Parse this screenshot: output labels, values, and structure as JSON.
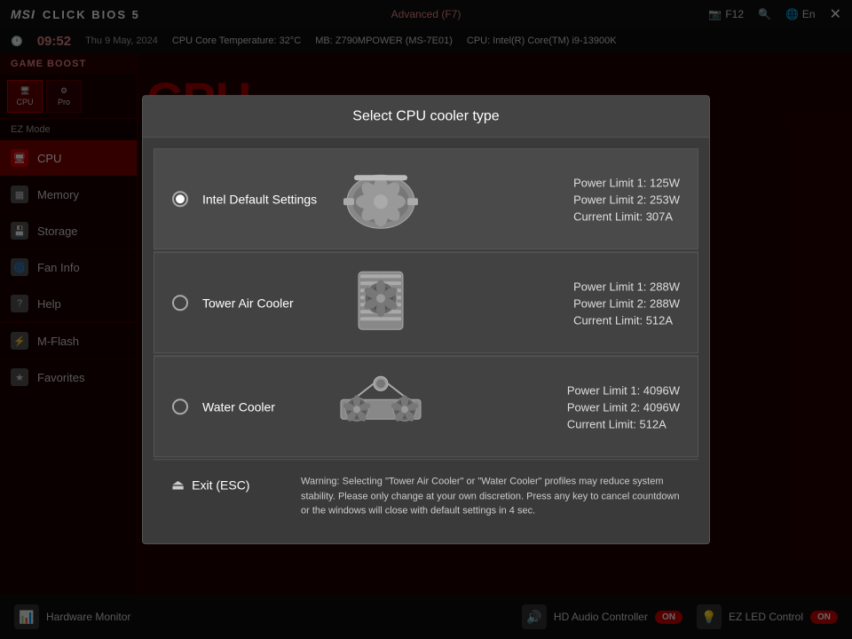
{
  "app": {
    "logo": "MSI",
    "title": "CLICK BIOS 5",
    "mode": "Advanced (F7)",
    "f12_label": "F12",
    "lang": "En"
  },
  "clock": {
    "time": "09:52",
    "date": "Thu 9 May, 2024"
  },
  "temps": {
    "cpu_core": "CPU Core Temperature: 32°C",
    "mb": "MB: Z790MPOWER (MS-7E01)",
    "cpu_info": "CPU: Intel(R) Core(TM) i9-13900K"
  },
  "sidebar": {
    "game_boost": "GAME BOOST",
    "ez_mode": "EZ Mode",
    "items": [
      {
        "id": "cpu",
        "label": "CPU",
        "active": true
      },
      {
        "id": "memory",
        "label": "Memory",
        "active": false
      },
      {
        "id": "storage",
        "label": "Storage",
        "active": false
      },
      {
        "id": "fan-info",
        "label": "Fan Info",
        "active": false
      },
      {
        "id": "help",
        "label": "Help",
        "active": false
      }
    ],
    "m_flash": "M-Flash",
    "favorites": "Favorites"
  },
  "bottom_bar": {
    "hw_monitor": "Hardware Monitor",
    "hd_audio": "HD Audio Controller",
    "hd_toggle": "ON",
    "ez_led": "EZ LED Control",
    "ez_toggle": "ON"
  },
  "dialog": {
    "title": "Select CPU cooler type",
    "options": [
      {
        "id": "intel-default",
        "name": "Intel Default Settings",
        "selected": true,
        "power_limit_1": "Power Limit 1: 125W",
        "power_limit_2": "Power Limit 2: 253W",
        "current_limit": "Current Limit: 307A",
        "image_type": "fan-top"
      },
      {
        "id": "tower-air",
        "name": "Tower Air Cooler",
        "selected": false,
        "power_limit_1": "Power Limit 1: 288W",
        "power_limit_2": "Power Limit 2: 288W",
        "current_limit": "Current Limit: 512A",
        "image_type": "fan-side"
      },
      {
        "id": "water-cooler",
        "name": "Water Cooler",
        "selected": false,
        "power_limit_1": "Power Limit 1: 4096W",
        "power_limit_2": "Power Limit 2: 4096W",
        "current_limit": "Current Limit: 512A",
        "image_type": "fan-water"
      }
    ],
    "exit_label": "Exit (ESC)",
    "warning": "Warning: Selecting \"Tower Air Cooler\" or \"Water Cooler\" profiles may reduce system stability. Please only change at your own discretion. Press any key to cancel countdown or the windows will close with default settings in 4 sec."
  }
}
